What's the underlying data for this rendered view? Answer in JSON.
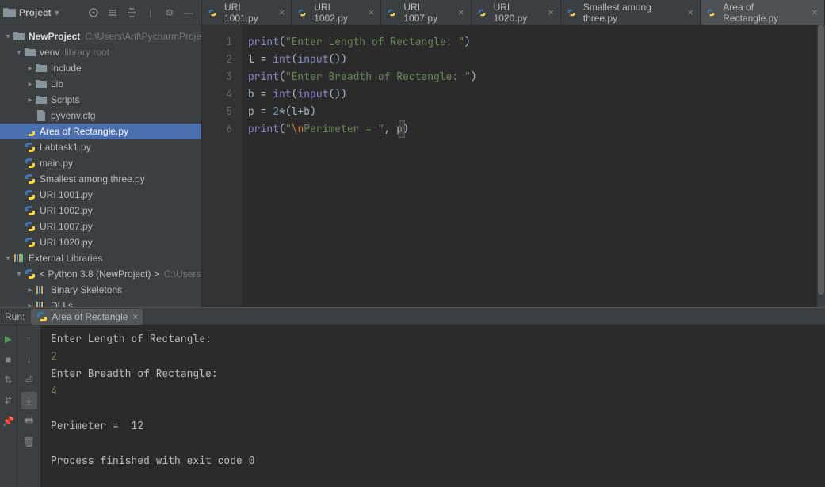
{
  "sidebar": {
    "project_label": "Project",
    "root": {
      "name": "NewProject",
      "path": "C:\\Users\\Arif\\PycharmProje"
    },
    "venv": {
      "name": "venv",
      "hint": "library root"
    },
    "venv_children": [
      "Include",
      "Lib",
      "Scripts",
      "pyvenv.cfg"
    ],
    "files": [
      "Area of Rectangle.py",
      "Labtask1.py",
      "main.py",
      "Smallest among three.py",
      "URI 1001.py",
      "URI 1002.py",
      "URI 1007.py",
      "URI 1020.py"
    ],
    "ext_lib": "External Libraries",
    "python_env": "< Python 3.8 (NewProject) >",
    "python_env_path": "C:\\Users",
    "env_children": [
      "Binary Skeletons",
      "DLLs"
    ]
  },
  "tabs": [
    "URI 1001.py",
    "URI 1002.py",
    "URI 1007.py",
    "URI 1020.py",
    "Smallest among three.py",
    "Area of Rectangle.py"
  ],
  "code": {
    "lines": [
      {
        "n": "1",
        "tokens": [
          {
            "t": "print",
            "c": "kw-call"
          },
          {
            "t": "(",
            "c": "paren"
          },
          {
            "t": "\"Enter Length of Rectangle: \"",
            "c": "str"
          },
          {
            "t": ")",
            "c": "paren"
          }
        ]
      },
      {
        "n": "2",
        "tokens": [
          {
            "t": "l = ",
            "c": "op"
          },
          {
            "t": "int",
            "c": "builtin"
          },
          {
            "t": "(",
            "c": "paren"
          },
          {
            "t": "input",
            "c": "builtin"
          },
          {
            "t": "())",
            "c": "paren"
          }
        ]
      },
      {
        "n": "3",
        "tokens": [
          {
            "t": "print",
            "c": "kw-call"
          },
          {
            "t": "(",
            "c": "paren"
          },
          {
            "t": "\"Enter Breadth of Rectangle: \"",
            "c": "str"
          },
          {
            "t": ")",
            "c": "paren"
          }
        ]
      },
      {
        "n": "4",
        "tokens": [
          {
            "t": "b = ",
            "c": "op"
          },
          {
            "t": "int",
            "c": "builtin"
          },
          {
            "t": "(",
            "c": "paren"
          },
          {
            "t": "input",
            "c": "builtin"
          },
          {
            "t": "())",
            "c": "paren"
          }
        ]
      },
      {
        "n": "5",
        "tokens": [
          {
            "t": "p = ",
            "c": "op"
          },
          {
            "t": "2",
            "c": "num"
          },
          {
            "t": "*(l+b)",
            "c": "op"
          }
        ]
      },
      {
        "n": "6",
        "tokens": [
          {
            "t": "print",
            "c": "kw-call"
          },
          {
            "t": "(",
            "c": "paren"
          },
          {
            "t": "\"",
            "c": "str"
          },
          {
            "t": "\\n",
            "c": "esc"
          },
          {
            "t": "Perimeter = \"",
            "c": "str"
          },
          {
            "t": ", p",
            "c": "op"
          },
          {
            "t": ")",
            "c": "paren"
          }
        ]
      }
    ]
  },
  "run": {
    "label": "Run:",
    "tab": "Area of Rectangle",
    "console": [
      {
        "t": "Enter Length of Rectangle: ",
        "c": ""
      },
      {
        "t": "2",
        "c": "input-val"
      },
      {
        "t": "Enter Breadth of Rectangle: ",
        "c": ""
      },
      {
        "t": "4",
        "c": "input-val"
      },
      {
        "t": "",
        "c": ""
      },
      {
        "t": "Perimeter =  12",
        "c": ""
      },
      {
        "t": "",
        "c": ""
      },
      {
        "t": "Process finished with exit code 0",
        "c": ""
      }
    ]
  }
}
